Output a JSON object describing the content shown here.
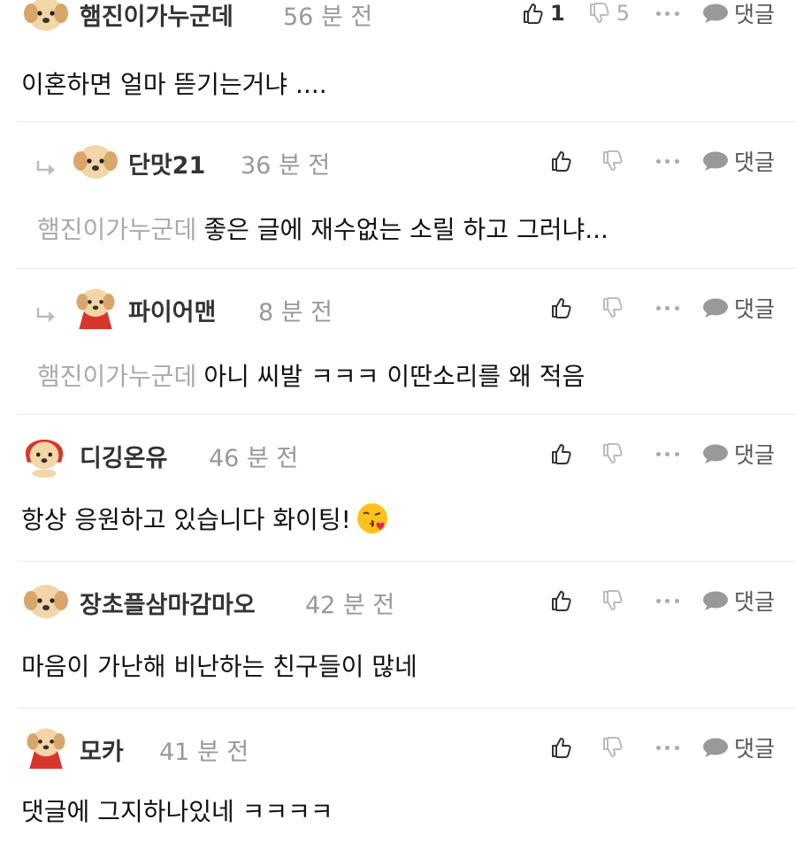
{
  "comments": [
    {
      "name": "햄진이가누군데",
      "time": "56 분 전",
      "text": "이혼하면 얼마 뜯기는거냐 ....",
      "likes": "1",
      "dislikes": "5",
      "reply": "댓글",
      "avatar": "puppy-avatar"
    },
    {
      "name": "단맛21",
      "time": "36 분 전",
      "mention": "햄진이가누군데",
      "text": "좋은 글에 재수없는 소릴 하고 그러냐...",
      "reply": "댓글",
      "avatar": "puppy-avatar"
    },
    {
      "name": "파이어맨",
      "time": "8 분 전",
      "mention": "햄진이가누군데",
      "text": "아니 씨발 ㅋㅋㅋ 이딴소리를 왜 적음",
      "reply": "댓글",
      "avatar": "puppy-red-cape-avatar"
    },
    {
      "name": "디깅온유",
      "time": "46 분 전",
      "text": "항상 응원하고 있습니다 화이팅!",
      "emoji": "kissing-face-emoji",
      "reply": "댓글",
      "avatar": "puppy-red-hood-avatar"
    },
    {
      "name": "장초플삼마감마오",
      "time": "42 분 전",
      "text": "마음이 가난해 비난하는 친구들이 많네",
      "reply": "댓글",
      "avatar": "puppy-avatar"
    },
    {
      "name": "모카",
      "time": "41 분 전",
      "text": "댓글에 그지하나있네 ㅋㅋㅋㅋ",
      "reply": "댓글",
      "avatar": "puppy-red-cape-avatar"
    }
  ],
  "colors": {
    "username": "#333333",
    "meta": "#999999",
    "mention": "#aaaaaa",
    "separator": "#e9e9e9"
  }
}
